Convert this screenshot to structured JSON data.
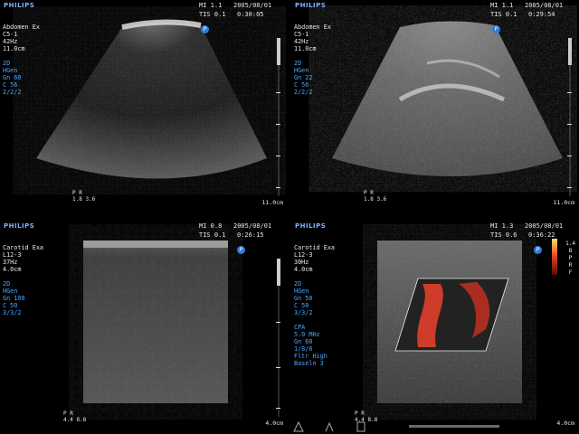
{
  "panels": [
    {
      "brand": "PHILIPS",
      "mi": "MI 1.1",
      "tis": "TIS 0.1",
      "date": "2005/08/01",
      "time": "0:30:05",
      "info_white": [
        "Abdomen Ex",
        "C5-1",
        "42Hz",
        "11.0cm"
      ],
      "info_blue": [
        "2D",
        "HGen",
        "Gn 60",
        "C 56",
        "2/2/2"
      ],
      "depth": "11.0cm",
      "probe": [
        "P",
        "R",
        "1.8 3.6"
      ]
    },
    {
      "brand": "PHILIPS",
      "mi": "MI 1.1",
      "tis": "TIS 0.1",
      "date": "2005/08/01",
      "time": "0:29:54",
      "info_white": [
        "Abdomen Ex",
        "C5-1",
        "42Hz",
        "11.0cm"
      ],
      "info_blue": [
        "2D",
        "HGen",
        "Gn 22",
        "C 56",
        "2/2/2"
      ],
      "depth": "11.0cm",
      "probe": [
        "P",
        "R",
        "1.8 3.6"
      ]
    },
    {
      "brand": "PHILIPS",
      "mi": "MI 0.8",
      "tis": "TIS 0.1",
      "date": "2005/08/01",
      "time": "0:26:15",
      "info_white": [
        "Carotid Exa",
        "L12-3",
        "37Hz",
        "4.0cm"
      ],
      "info_blue": [
        "2D",
        "HGen",
        "Gn 100",
        "C 50",
        "3/3/2"
      ],
      "depth": "4.0cm",
      "probe": [
        "P",
        "R",
        "4.4 8.8"
      ]
    },
    {
      "brand": "PHILIPS",
      "mi": "MI 1.3",
      "tis": "TIS 0.6",
      "date": "2005/08/01",
      "time": "0:36:22",
      "info_white": [
        "Carotid Exa",
        "L12-3",
        "30Hz",
        "4.0cm"
      ],
      "info_blue": [
        "2D",
        "HGen",
        "Gn 50",
        "C 50",
        "3/3/2",
        "",
        "CPA",
        "5.0 MHz",
        "Gn 60",
        "1/8/6",
        "Fltr High",
        "Baseln 3"
      ],
      "depth": "4.0cm",
      "probe": [
        "P",
        "R",
        "4.4 8.8"
      ],
      "color_bar_labels": [
        "1.4",
        "B",
        "P",
        "R",
        "F"
      ]
    }
  ],
  "colors": {
    "brand": "#7fb2ff",
    "info_blue": "#4aa6ff",
    "badge": "#2f7be0",
    "doppler": "#e0402a"
  }
}
